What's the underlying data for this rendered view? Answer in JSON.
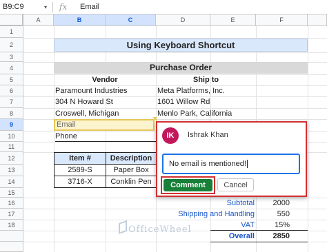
{
  "formula_bar": {
    "name_box": "B9:C9",
    "dropdown_icon": "▾",
    "fx_label": "fx",
    "value": "Email"
  },
  "columns": [
    "A",
    "B",
    "C",
    "D",
    "E",
    "F"
  ],
  "rows": [
    "1",
    "2",
    "3",
    "4",
    "5",
    "6",
    "7",
    "8",
    "9",
    "10",
    "11",
    "12",
    "13",
    "14",
    "15",
    "16",
    "17",
    "18"
  ],
  "selected_row": "9",
  "sheet": {
    "title": "Using Keyboard Shortcut",
    "purchase_order": "Purchase Order",
    "vendor_header": "Vendor",
    "shipto_header": "Ship to",
    "vendor_lines": [
      "Paramount Industries",
      "304 N Howard St",
      "Croswell, Michigan"
    ],
    "shipto_lines": [
      "Meta Platforms, Inc.",
      "1601 Willow Rd",
      "Menlo Park, California"
    ],
    "email_label": "Email",
    "phone_label": "Phone",
    "item_headers": [
      "Item #",
      "Description"
    ],
    "items": [
      {
        "item": "2589-S",
        "desc": "Paper Box"
      },
      {
        "item": "3716-X",
        "desc": "Conklin Pen"
      }
    ],
    "summary": [
      {
        "label": "Subtotal",
        "value": "2000"
      },
      {
        "label": "Shipping and Handling",
        "value": "550"
      },
      {
        "label": "VAT",
        "value": "15%"
      },
      {
        "label": "Overall",
        "value": "2850"
      }
    ]
  },
  "comment": {
    "avatar_initials": "IK",
    "author": "Ishrak Khan",
    "text": "No email is mentioned!",
    "submit_label": "Comment",
    "cancel_label": "Cancel"
  },
  "watermark": "OfficeWheel",
  "colors": {
    "accent_green": "#188038",
    "highlight_red": "#d32f2f",
    "title_fill": "#dae8fc"
  }
}
